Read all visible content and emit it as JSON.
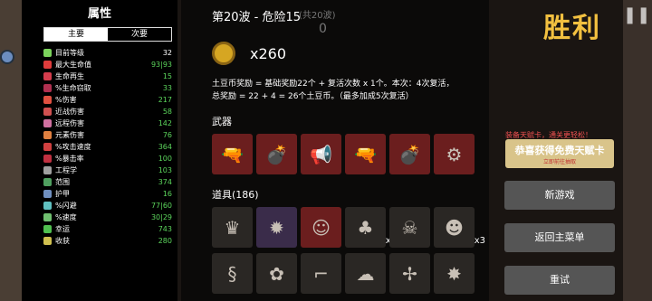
{
  "stats": {
    "title": "属性",
    "tabs": [
      "主要",
      "次要"
    ],
    "rows": [
      {
        "label": "目前等级",
        "value": "32",
        "color": "#fff",
        "ico": "#7bd35c",
        "icon": "level-icon"
      },
      {
        "label": "最大生命值",
        "value": "93|93",
        "color": "#5cd65c",
        "ico": "#e03c3c",
        "icon": "heart-icon"
      },
      {
        "label": "生命再生",
        "value": "15",
        "color": "#5cd65c",
        "ico": "#d43c4c",
        "icon": "regen-icon"
      },
      {
        "label": "%生命窃取",
        "value": "33",
        "color": "#5cd65c",
        "ico": "#b03050",
        "icon": "lifesteal-icon"
      },
      {
        "label": "%伤害",
        "value": "217",
        "color": "#5cd65c",
        "ico": "#e05040",
        "icon": "damage-icon"
      },
      {
        "label": "近战伤害",
        "value": "58",
        "color": "#5cd65c",
        "ico": "#d05050",
        "icon": "melee-icon"
      },
      {
        "label": "远程伤害",
        "value": "142",
        "color": "#5cd65c",
        "ico": "#d070a0",
        "icon": "ranged-icon"
      },
      {
        "label": "元素伤害",
        "value": "76",
        "color": "#5cd65c",
        "ico": "#e08040",
        "icon": "elemental-icon"
      },
      {
        "label": "%攻击速度",
        "value": "364",
        "color": "#5cd65c",
        "ico": "#d04040",
        "icon": "attack-speed-icon"
      },
      {
        "label": "%暴击率",
        "value": "100",
        "color": "#5cd65c",
        "ico": "#c03040",
        "icon": "crit-icon"
      },
      {
        "label": "工程学",
        "value": "103",
        "color": "#5cd65c",
        "ico": "#a0a0a0",
        "icon": "engineering-icon"
      },
      {
        "label": "范围",
        "value": "374",
        "color": "#5cd65c",
        "ico": "#50a060",
        "icon": "range-icon"
      },
      {
        "label": "护甲",
        "value": "16",
        "color": "#5cd65c",
        "ico": "#7090c0",
        "icon": "armor-icon"
      },
      {
        "label": "%闪避",
        "value": "77|60",
        "color": "#5cd65c",
        "ico": "#60c0c0",
        "icon": "dodge-icon"
      },
      {
        "label": "%速度",
        "value": "30|29",
        "color": "#5cd65c",
        "ico": "#70c070",
        "icon": "speed-icon"
      },
      {
        "label": "幸运",
        "value": "743",
        "color": "#5cd65c",
        "ico": "#50c050",
        "icon": "luck-icon"
      },
      {
        "label": "收获",
        "value": "280",
        "color": "#5cd65c",
        "ico": "#d0c050",
        "icon": "harvest-icon"
      }
    ]
  },
  "main": {
    "wave": "第20波 - 危险15",
    "coins": "x260",
    "reward_line1": "土豆币奖励 = 基础奖励22个 + 复活次数 x 1个。本次：4次复活，",
    "reward_line2": "总奖励 = 22 + 4 = 26个土豆币。（最多加成5次复活）",
    "weapons_title": "武器",
    "items_title": "道具(186)",
    "weapons": [
      {
        "icon": "gun-icon",
        "glyph": "🔫"
      },
      {
        "icon": "rocket-launcher-icon",
        "glyph": "💣"
      },
      {
        "icon": "megaphone-icon",
        "glyph": "📢"
      },
      {
        "icon": "blaster-icon",
        "glyph": "🔫"
      },
      {
        "icon": "rocket-launcher-icon",
        "glyph": "💣"
      },
      {
        "icon": "minigun-icon",
        "glyph": "⚙"
      }
    ],
    "items_row1": [
      {
        "icon": "crown-item-icon",
        "glyph": "♛",
        "cnt": ""
      },
      {
        "icon": "spiked-ball-icon",
        "glyph": "✹",
        "cnt": ""
      },
      {
        "icon": "clown-face-icon",
        "glyph": "☺",
        "cnt": ""
      },
      {
        "icon": "tree-icon",
        "glyph": "♣",
        "cnt": "x6"
      },
      {
        "icon": "ghost-mask-icon",
        "glyph": "☠",
        "cnt": ""
      },
      {
        "icon": "skull-icon",
        "glyph": "☻",
        "cnt": "x3"
      }
    ],
    "items_row2": [
      {
        "icon": "snake-icon",
        "glyph": "§"
      },
      {
        "icon": "bee-icon",
        "glyph": "✿"
      },
      {
        "icon": "pipe-icon",
        "glyph": "⌐"
      },
      {
        "icon": "ghost-icon",
        "glyph": "☁"
      },
      {
        "icon": "propeller-hat-icon",
        "glyph": "✢"
      },
      {
        "icon": "dynamite-icon",
        "glyph": "✸"
      }
    ],
    "ghost_text": "(共20波)",
    "ghost_num": "0"
  },
  "right": {
    "victory": "胜利",
    "promo_text": "装备天赋卡，通关更轻松！",
    "promo_main": "恭喜获得免费天赋卡",
    "promo_sub": "立即前往抽取",
    "new_game": "新游戏",
    "main_menu": "返回主菜单",
    "retry": "重试"
  }
}
